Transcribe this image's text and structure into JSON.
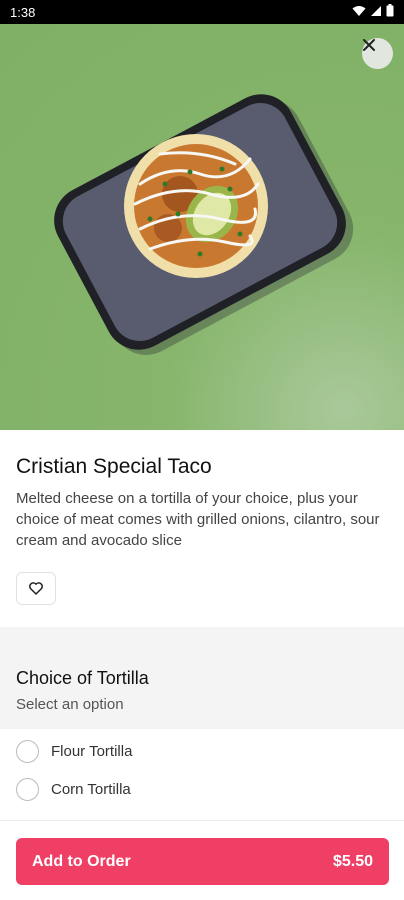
{
  "status_bar": {
    "time": "1:38",
    "icons": [
      "wifi-icon",
      "signal-icon",
      "battery-icon"
    ]
  },
  "hero": {
    "close_icon": "close-icon",
    "background_color": "#7fb065"
  },
  "item": {
    "title": "Cristian Special Taco",
    "description": "Melted cheese on a tortilla of your choice, plus your choice of meat comes with grilled onions, cilantro, sour cream and avocado slice",
    "favorite_icon": "heart-icon"
  },
  "options_section": {
    "title": "Choice of Tortilla",
    "subtitle": "Select an option",
    "options": [
      {
        "label": "Flour Tortilla"
      },
      {
        "label": "Corn Tortilla"
      }
    ]
  },
  "cta": {
    "label": "Add to Order",
    "price": "$5.50",
    "color": "#ef3f65"
  }
}
